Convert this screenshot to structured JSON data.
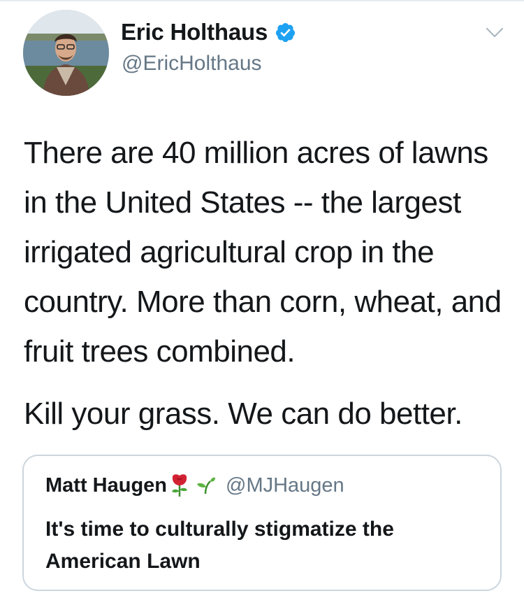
{
  "tweet": {
    "author": {
      "display_name": "Eric Holthaus",
      "handle": "@EricHolthaus",
      "verified": true,
      "avatar": "profile-photo"
    },
    "paragraphs": [
      "There are 40 million acres of lawns in the United States -- the largest irrigated agricultural crop in the country. More than corn, wheat, and fruit trees combined.",
      "Kill your grass. We can do better."
    ],
    "menu_icon": "chevron-down-icon",
    "quoted": {
      "display_name": "Matt Haugen",
      "name_emoji": [
        "rose-icon",
        "seedling-icon"
      ],
      "handle": "@MJHaugen",
      "text": "It's time to culturally stigmatize the American Lawn"
    }
  },
  "colors": {
    "text": "#14171a",
    "secondary": "#657786",
    "verified_blue": "#1da1f2",
    "border": "#ccd6dd"
  }
}
